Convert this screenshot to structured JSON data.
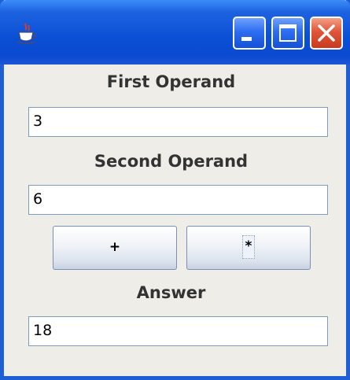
{
  "window": {
    "app_icon": "java-coffee-cup-icon",
    "controls": [
      "minimize-icon",
      "maximize-icon",
      "close-icon"
    ]
  },
  "form": {
    "first_operand_label": "First Operand",
    "first_operand_value": "3",
    "second_operand_label": "Second Operand",
    "second_operand_value": "6",
    "plus_label": "+",
    "times_label": "*",
    "answer_label": "Answer",
    "answer_value": "18"
  }
}
